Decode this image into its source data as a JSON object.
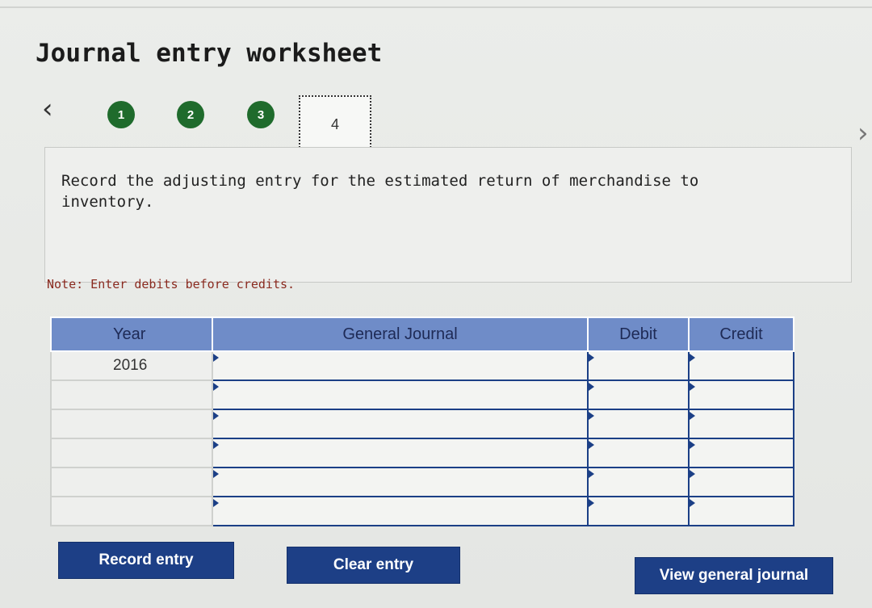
{
  "page_title": "Journal entry worksheet",
  "navigation": {
    "prev_icon": "chevron-left-icon",
    "next_icon": "chevron-right-icon",
    "steps": [
      {
        "label": "1",
        "state": "completed"
      },
      {
        "label": "2",
        "state": "completed"
      },
      {
        "label": "3",
        "state": "completed"
      },
      {
        "label": "4",
        "state": "current"
      }
    ]
  },
  "instruction": "Record the adjusting entry for the estimated return of merchandise to inventory.",
  "note": "Note: Enter debits before credits.",
  "journal_table": {
    "headers": {
      "year": "Year",
      "general_journal": "General Journal",
      "debit": "Debit",
      "credit": "Credit"
    },
    "rows": [
      {
        "year": "2016",
        "account": "",
        "debit": "",
        "credit": ""
      },
      {
        "year": "",
        "account": "",
        "debit": "",
        "credit": ""
      },
      {
        "year": "",
        "account": "",
        "debit": "",
        "credit": ""
      },
      {
        "year": "",
        "account": "",
        "debit": "",
        "credit": ""
      },
      {
        "year": "",
        "account": "",
        "debit": "",
        "credit": ""
      },
      {
        "year": "",
        "account": "",
        "debit": "",
        "credit": ""
      }
    ]
  },
  "buttons": {
    "record": "Record entry",
    "clear": "Clear entry",
    "view": "View general journal"
  },
  "colors": {
    "step_completed": "#1f6b2c",
    "header_bg": "#6f8cc8",
    "button_bg": "#1d3f86",
    "note_text": "#8a2a1f"
  }
}
